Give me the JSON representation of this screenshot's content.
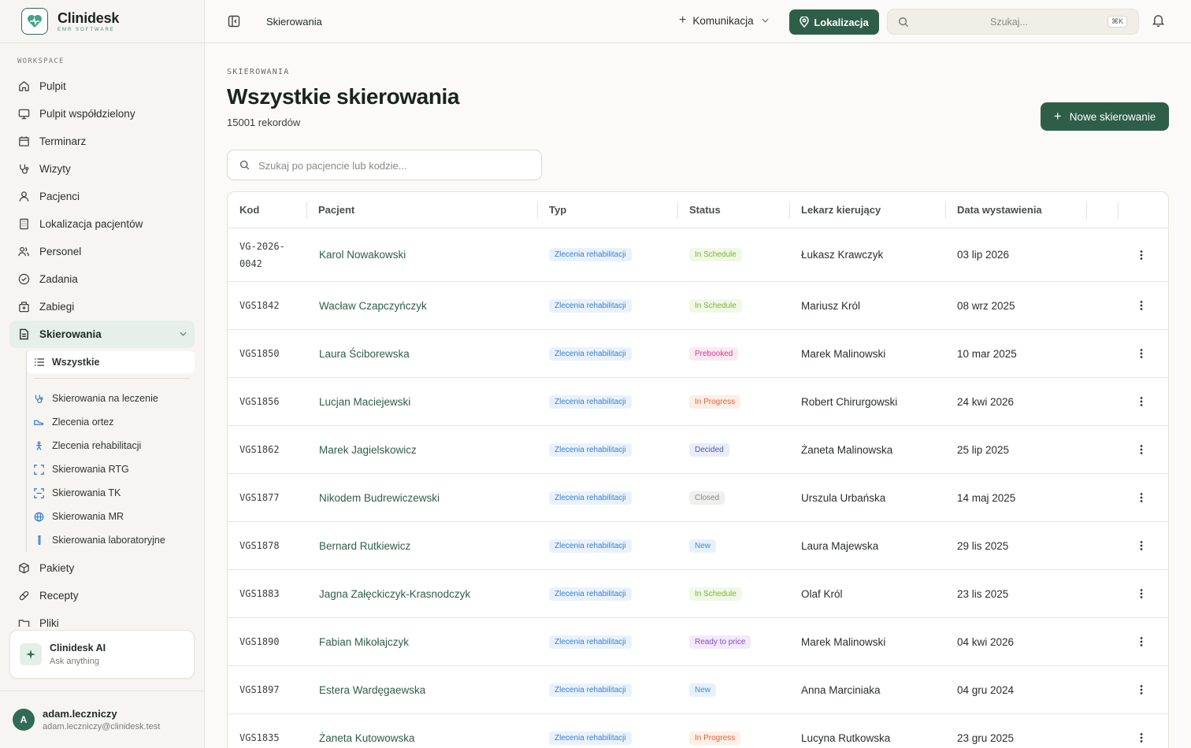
{
  "brand": {
    "name": "Clinidesk",
    "sub": "EMR SOFTWARE"
  },
  "sidebar": {
    "section_label": "WORKSPACE",
    "items": [
      {
        "label": "Pulpit",
        "icon": "home-icon"
      },
      {
        "label": "Pulpit współdzielony",
        "icon": "monitor-icon"
      },
      {
        "label": "Terminarz",
        "icon": "calendar-icon"
      },
      {
        "label": "Wizyty",
        "icon": "stethoscope-icon"
      },
      {
        "label": "Pacjenci",
        "icon": "user-icon"
      },
      {
        "label": "Lokalizacja pacjentów",
        "icon": "building-icon"
      },
      {
        "label": "Personel",
        "icon": "users-icon"
      },
      {
        "label": "Zadania",
        "icon": "check-circle-icon"
      },
      {
        "label": "Zabiegi",
        "icon": "hospital-icon"
      },
      {
        "label": "Skierowania",
        "icon": "file-icon",
        "active": true
      }
    ],
    "sub_items": [
      {
        "label": "Wszystkie",
        "active": true
      },
      {
        "label": "Skierowania na leczenie"
      },
      {
        "label": "Zlecenia ortez"
      },
      {
        "label": "Zlecenia rehabilitacji"
      },
      {
        "label": "Skierowania RTG"
      },
      {
        "label": "Skierowania TK"
      },
      {
        "label": "Skierowania MR"
      },
      {
        "label": "Skierowania laboratoryjne"
      }
    ],
    "items_after": [
      {
        "label": "Pakiety",
        "icon": "package-icon"
      },
      {
        "label": "Recepty",
        "icon": "pill-icon"
      },
      {
        "label": "Pliki",
        "icon": "folder-icon"
      }
    ],
    "ai": {
      "title": "Clinidesk AI",
      "subtitle": "Ask anything"
    },
    "user": {
      "initial": "A",
      "name": "adam.leczniczy",
      "email": "adam.leczniczy@clinidesk.test"
    }
  },
  "topbar": {
    "breadcrumb": "Skierowania",
    "communication": "Komunikacja",
    "location_button": "Lokalizacja",
    "search_placeholder": "Szukaj...",
    "shortcut": "⌘K"
  },
  "main": {
    "eyebrow": "SKIEROWANIA",
    "title": "Wszystkie skierowania",
    "record_count": "15001 rekordów",
    "new_button": "Nowe skierowanie",
    "filter_placeholder": "Szukaj po pacjencie lub kodzie..."
  },
  "table": {
    "columns": [
      "Kod",
      "Pacjent",
      "Typ",
      "Status",
      "Lekarz kierujący",
      "Data wystawienia"
    ],
    "rows": [
      {
        "code": "VG-2026-\n0042",
        "patient": "Karol Nowakowski",
        "type": "Zlecenia rehabilitacji",
        "status": "In Schedule",
        "status_class": "st-sched",
        "doctor": "Łukasz Krawczyk",
        "date": "03 lip 2026"
      },
      {
        "code": "VGS1842",
        "patient": "Wacław Czapczyńczyk",
        "type": "Zlecenia rehabilitacji",
        "status": "In Schedule",
        "status_class": "st-sched",
        "doctor": "Mariusz Król",
        "date": "08 wrz 2025"
      },
      {
        "code": "VGS1850",
        "patient": "Laura Ściborewska",
        "type": "Zlecenia rehabilitacji",
        "status": "Prebooked",
        "status_class": "st-pre",
        "doctor": "Marek Malinowski",
        "date": "10 mar 2025"
      },
      {
        "code": "VGS1856",
        "patient": "Lucjan Maciejewski",
        "type": "Zlecenia rehabilitacji",
        "status": "In Progress",
        "status_class": "st-prog",
        "doctor": "Robert Chirurgowski",
        "date": "24 kwi 2026"
      },
      {
        "code": "VGS1862",
        "patient": "Marek Jagielskowicz",
        "type": "Zlecenia rehabilitacji",
        "status": "Decided",
        "status_class": "st-dec",
        "doctor": "Żaneta Malinowska",
        "date": "25 lip 2025"
      },
      {
        "code": "VGS1877",
        "patient": "Nikodem Budrewiczewski",
        "type": "Zlecenia rehabilitacji",
        "status": "Closed",
        "status_class": "st-closed",
        "doctor": "Urszula Urbańska",
        "date": "14 maj 2025"
      },
      {
        "code": "VGS1878",
        "patient": "Bernard Rutkiewicz",
        "type": "Zlecenia rehabilitacji",
        "status": "New",
        "status_class": "st-new",
        "doctor": "Laura Majewska",
        "date": "29 lis 2025"
      },
      {
        "code": "VGS1883",
        "patient": "Jagna Załęckiczyk-Krasnodczyk",
        "type": "Zlecenia rehabilitacji",
        "status": "In Schedule",
        "status_class": "st-sched",
        "doctor": "Olaf Król",
        "date": "23 lis 2025"
      },
      {
        "code": "VGS1890",
        "patient": "Fabian Mikołajczyk",
        "type": "Zlecenia rehabilitacji",
        "status": "Ready to price",
        "status_class": "st-ready",
        "doctor": "Marek Malinowski",
        "date": "04 kwi 2026"
      },
      {
        "code": "VGS1897",
        "patient": "Estera Wardęgaewska",
        "type": "Zlecenia rehabilitacji",
        "status": "New",
        "status_class": "st-new",
        "doctor": "Anna Marciniaka",
        "date": "04 gru 2024"
      },
      {
        "code": "VGS1835",
        "patient": "Żaneta Kutowowska",
        "type": "Zlecenia rehabilitacji",
        "status": "In Progress",
        "status_class": "st-prog",
        "doctor": "Lucyna Rutkowska",
        "date": "23 gru 2025"
      }
    ]
  }
}
